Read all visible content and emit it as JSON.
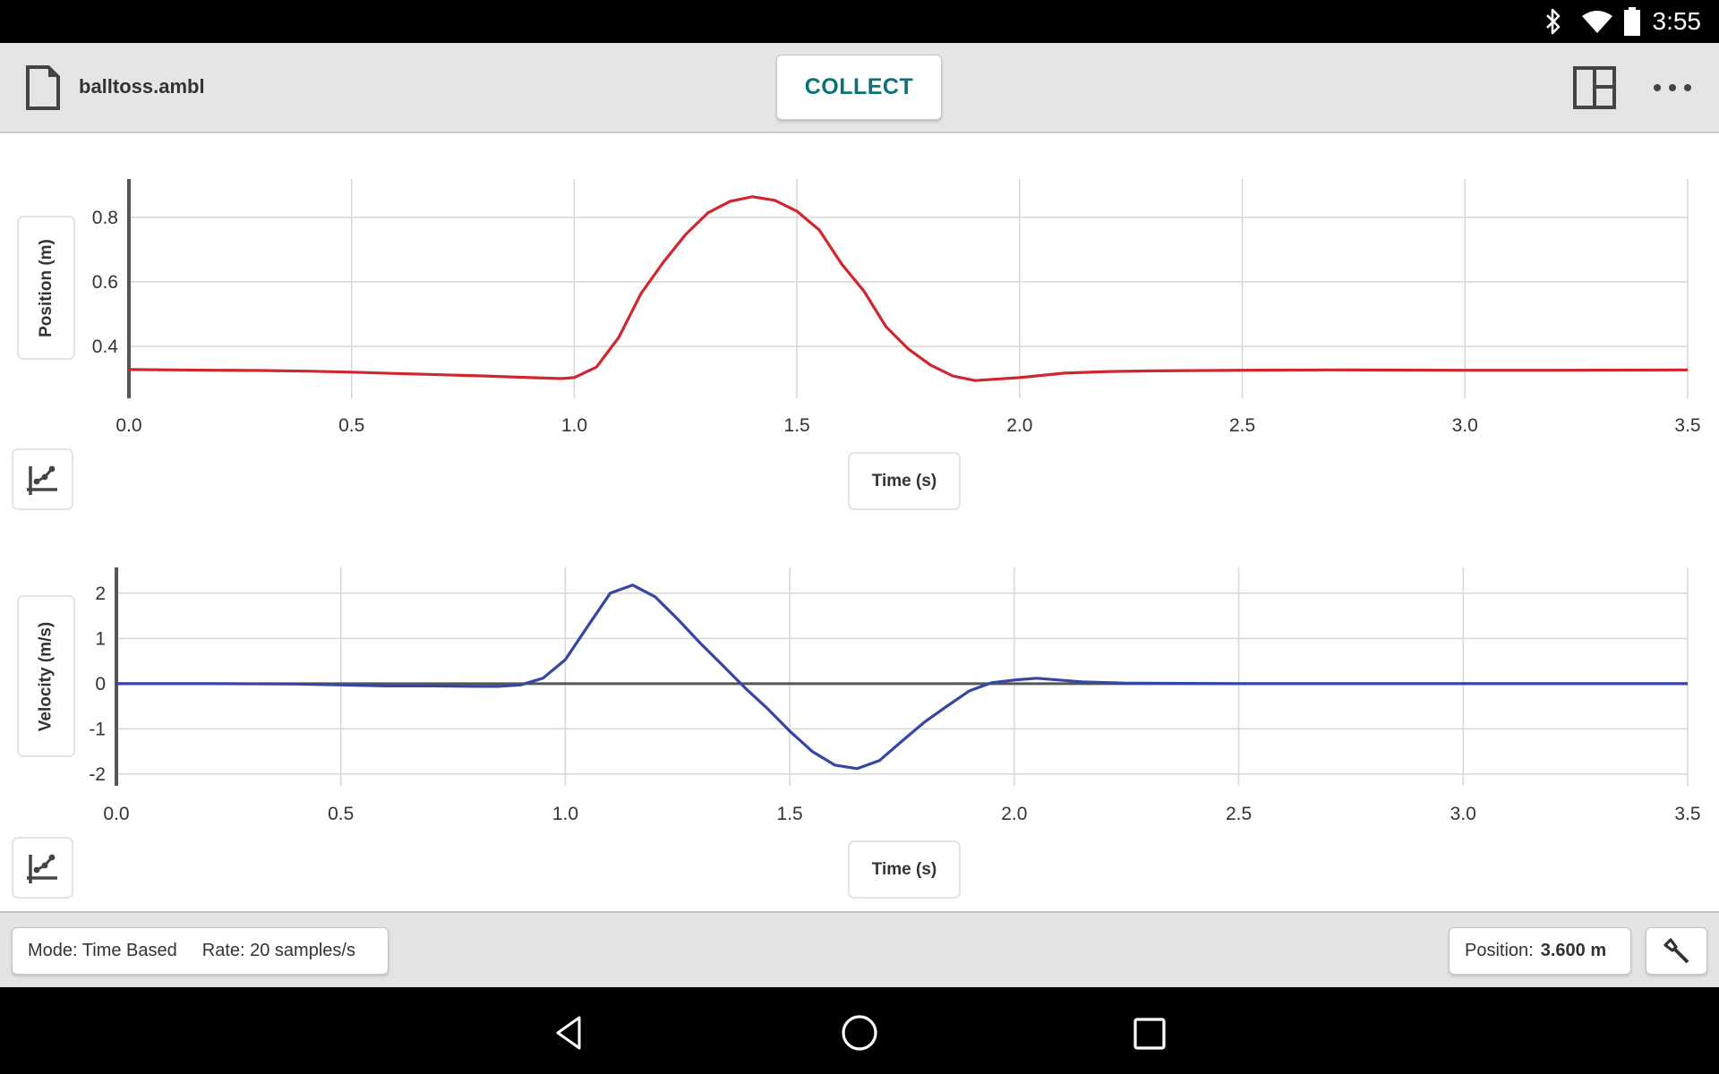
{
  "status_bar": {
    "time": "3:55",
    "icons": [
      "bluetooth-icon",
      "wifi-icon",
      "battery-icon"
    ]
  },
  "header": {
    "file_icon": "file-icon",
    "file_name": "balltoss.ambl",
    "collect_label": "COLLECT",
    "layout_icon": "layout-icon",
    "more_icon": "more-horizontal-icon"
  },
  "colors": {
    "accent": "#0b7377",
    "position_series": "#d0272f",
    "velocity_series": "#3546a3",
    "header_bg": "#e4e5e7",
    "grid": "#d6d6d6",
    "axis": "#555555"
  },
  "graphs": [
    {
      "y_label": "Position (m)",
      "x_label": "Time (s)",
      "options_icon": "graph-options-icon"
    },
    {
      "y_label": "Velocity (m/s)",
      "x_label": "Time (s)",
      "options_icon": "graph-options-icon"
    }
  ],
  "chart_data": [
    {
      "type": "line",
      "title": "",
      "xlabel": "Time (s)",
      "ylabel": "Position (m)",
      "xlim": [
        0,
        3.5
      ],
      "ylim": [
        0.239,
        0.919
      ],
      "x_ticks": [
        "0.0",
        "0.5",
        "1.0",
        "1.5",
        "2.0",
        "2.5",
        "3.0",
        "3.5"
      ],
      "x_tick_values": [
        0,
        0.5,
        1.0,
        1.5,
        2.0,
        2.5,
        3.0,
        3.5
      ],
      "y_ticks": [
        "0.4",
        "0.6",
        "0.8"
      ],
      "y_tick_values": [
        0.4,
        0.6,
        0.8
      ],
      "grid": true,
      "legend": "none",
      "series": [
        {
          "name": "Position",
          "x": [
            0,
            0.1,
            0.2,
            0.3,
            0.4,
            0.5,
            0.6,
            0.7,
            0.8,
            0.9,
            0.97,
            1.0,
            1.05,
            1.1,
            1.15,
            1.2,
            1.25,
            1.3,
            1.35,
            1.4,
            1.45,
            1.5,
            1.55,
            1.6,
            1.65,
            1.7,
            1.75,
            1.8,
            1.85,
            1.9,
            2.0,
            2.1,
            2.2,
            2.3,
            2.5,
            2.7,
            3.0,
            3.2,
            3.5
          ],
          "values": [
            0.328,
            0.327,
            0.326,
            0.325,
            0.323,
            0.32,
            0.316,
            0.312,
            0.308,
            0.303,
            0.3,
            0.303,
            0.336,
            0.428,
            0.564,
            0.661,
            0.747,
            0.814,
            0.85,
            0.864,
            0.853,
            0.819,
            0.761,
            0.656,
            0.572,
            0.461,
            0.392,
            0.342,
            0.308,
            0.294,
            0.303,
            0.317,
            0.322,
            0.324,
            0.326,
            0.327,
            0.326,
            0.326,
            0.327
          ]
        }
      ]
    },
    {
      "type": "line",
      "title": "",
      "xlabel": "Time (s)",
      "ylabel": "Velocity (m/s)",
      "xlim": [
        0,
        3.5
      ],
      "ylim": [
        -2.26,
        2.57
      ],
      "x_ticks": [
        "0.0",
        "0.5",
        "1.0",
        "1.5",
        "2.0",
        "2.5",
        "3.0",
        "3.5"
      ],
      "x_tick_values": [
        0,
        0.5,
        1.0,
        1.5,
        2.0,
        2.5,
        3.0,
        3.5
      ],
      "y_ticks": [
        "2",
        "1",
        "0",
        "-1",
        "-2"
      ],
      "y_tick_values": [
        2,
        1,
        0,
        -1,
        -2
      ],
      "grid": true,
      "zero_line": true,
      "legend": "none",
      "series": [
        {
          "name": "Velocity",
          "x": [
            0,
            0.2,
            0.4,
            0.5,
            0.6,
            0.7,
            0.8,
            0.85,
            0.9,
            0.95,
            1.0,
            1.05,
            1.1,
            1.15,
            1.2,
            1.25,
            1.3,
            1.35,
            1.4,
            1.45,
            1.5,
            1.55,
            1.6,
            1.65,
            1.7,
            1.75,
            1.8,
            1.85,
            1.9,
            1.95,
            2.0,
            2.05,
            2.1,
            2.15,
            2.25,
            2.5,
            3.0,
            3.5
          ],
          "values": [
            0.0,
            0.0,
            -0.01,
            -0.03,
            -0.05,
            -0.05,
            -0.06,
            -0.06,
            -0.03,
            0.12,
            0.53,
            1.27,
            2.0,
            2.18,
            1.92,
            1.43,
            0.9,
            0.41,
            -0.09,
            -0.55,
            -1.05,
            -1.5,
            -1.8,
            -1.88,
            -1.7,
            -1.27,
            -0.85,
            -0.5,
            -0.16,
            0.02,
            0.08,
            0.12,
            0.08,
            0.04,
            0.01,
            0.0,
            0.0,
            0.0
          ]
        }
      ]
    }
  ],
  "bottom_bar": {
    "mode_text": "Mode: Time Based",
    "rate_text": "Rate: 20 samples/s",
    "position_label": "Position:",
    "position_value": "3.600 m",
    "tool_icon": "probe-tool-icon"
  },
  "nav_bar": {
    "icons": [
      "back-icon",
      "home-icon",
      "recents-icon"
    ]
  }
}
